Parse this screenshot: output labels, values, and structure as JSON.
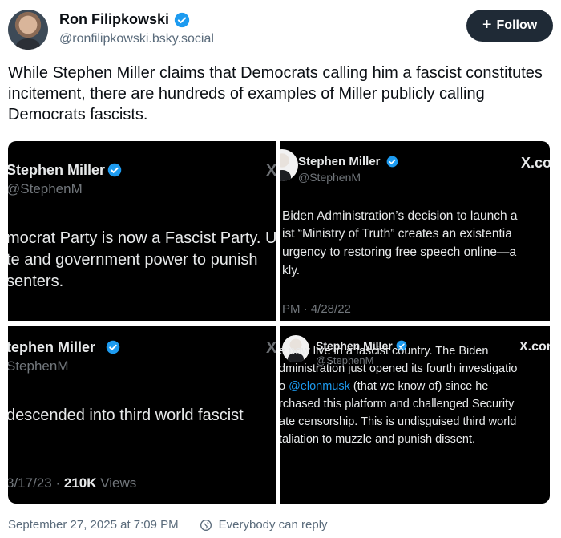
{
  "author": {
    "name": "Ron Filipkowski",
    "handle": "@ronfilipkowski.bsky.social"
  },
  "follow_label": "Follow",
  "post_text": "While Stephen Miller claims that Democrats calling him a fascist constitutes incitement, there are hundreds of examples of Miller publicly calling Democrats fascists.",
  "images": [
    {
      "name": "Stephen Miller",
      "handle": "@StephenM",
      "lines": [
        "mocrat Party is now a Fascist Party. U",
        "te and government power to punish",
        "senters."
      ]
    },
    {
      "name": "Stephen Miller",
      "handle": "@StephenM",
      "xlogo": "X.co",
      "lines": [
        "Biden Administration’s decision to launch a",
        "ist “Ministry of Truth” creates an existentia",
        "urgency to restoring free speech online—a",
        "kly."
      ],
      "meta": "PM · 4/28/22"
    },
    {
      "name": "tephen Miller",
      "handle": "StephenM",
      "lines": [
        "descended into third world fascist"
      ],
      "meta_date": "3/17/23 · ",
      "meta_views": "210K",
      "meta_views_label": " Views"
    },
    {
      "name": "Stephen Miller",
      "handle": "@StephenM",
      "xlogo": "X.con",
      "lines": [
        "e now live in a fascist country. The Biden",
        "dministration just opened its fourth investigatio",
        "rchased this platform and challenged Security",
        "ate censorship. This is undisguised third world",
        "taliation to muzzle and punish dissent."
      ],
      "line3_pre": "o ",
      "line3_link": "@elonmusk",
      "line3_post": " (that we know of) since he"
    }
  ],
  "footer": {
    "timestamp": "September 27, 2025 at 7:09 PM",
    "reply_setting": "Everybody can reply"
  },
  "colors": {
    "verified": "#1d9bf0",
    "follow_bg": "#1f2a36",
    "tile_bg": "#000000"
  }
}
